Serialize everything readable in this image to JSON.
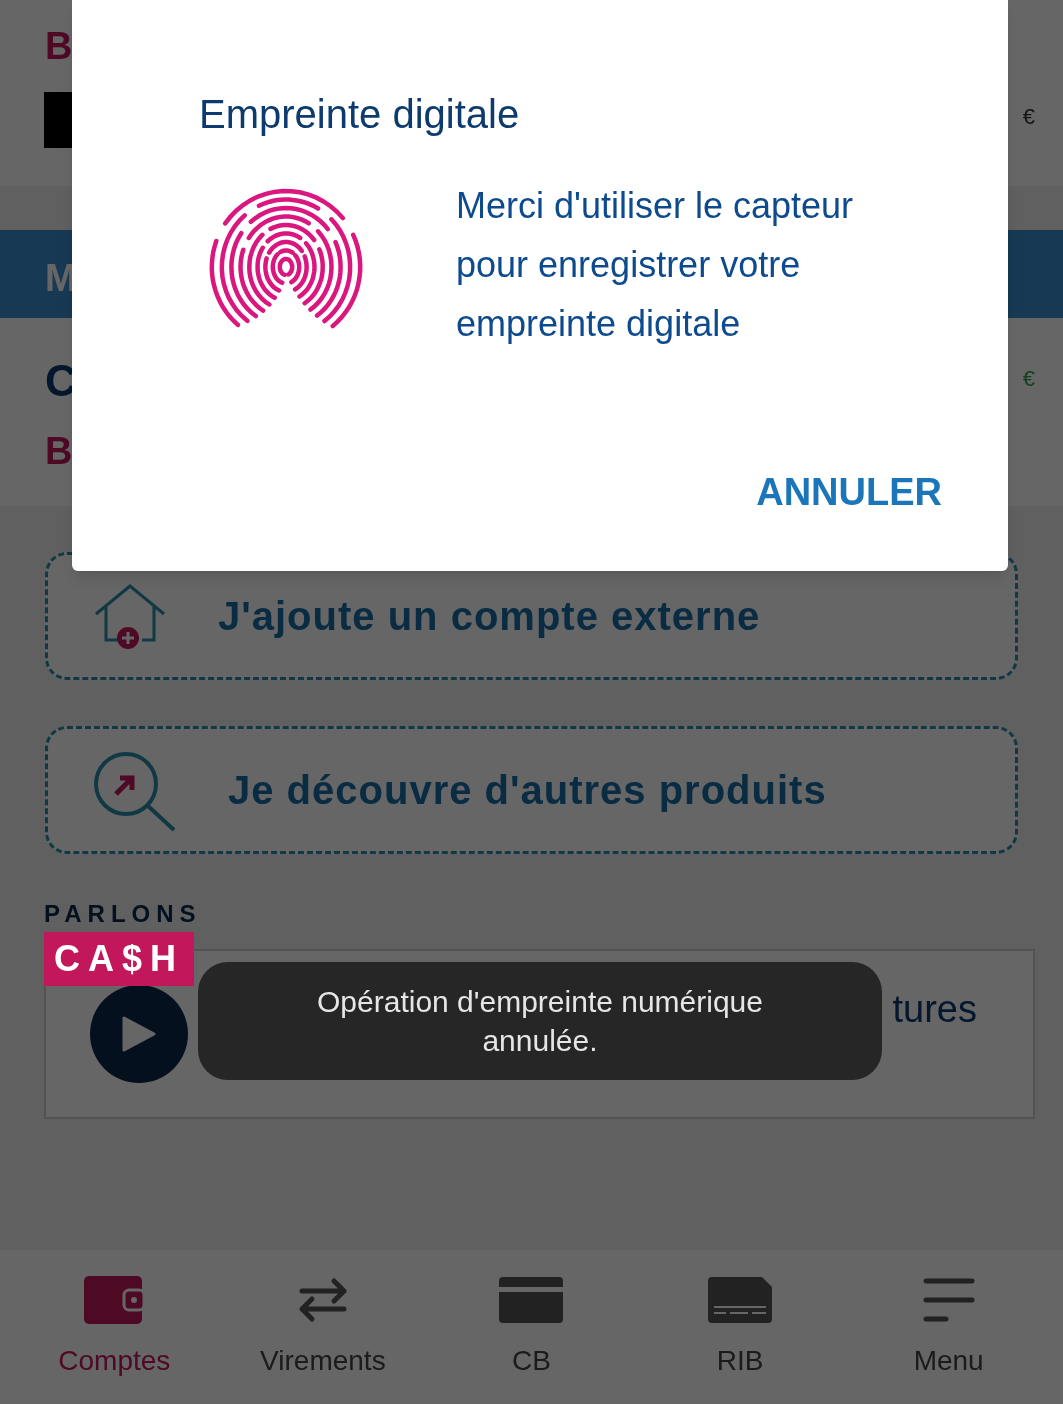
{
  "background": {
    "top_card": {
      "title": "B",
      "amount": "€"
    },
    "section_header": "M",
    "account": {
      "name": "C",
      "label": "B",
      "amount": "€"
    },
    "actions": [
      {
        "label": "J'ajoute un compte externe",
        "kind": "house"
      },
      {
        "label": "Je découvre d'autres produits",
        "kind": "search"
      }
    ],
    "promo": {
      "brand_top": "PARLONS",
      "brand_bottom": "CA$H",
      "title": "tures"
    }
  },
  "nav": [
    {
      "label": "Comptes",
      "kind": "wallet",
      "selected": true
    },
    {
      "label": "Virements",
      "kind": "transfer",
      "selected": false
    },
    {
      "label": "CB",
      "kind": "card",
      "selected": false
    },
    {
      "label": "RIB",
      "kind": "rib",
      "selected": false
    },
    {
      "label": "Menu",
      "kind": "menu",
      "selected": false
    }
  ],
  "dialog": {
    "title": "Empreinte digitale",
    "message": "Merci d'utiliser le capteur pour enregistrer votre empreinte digitale",
    "button": "ANNULER"
  },
  "toast": "Opération d'empreinte numérique annulée."
}
